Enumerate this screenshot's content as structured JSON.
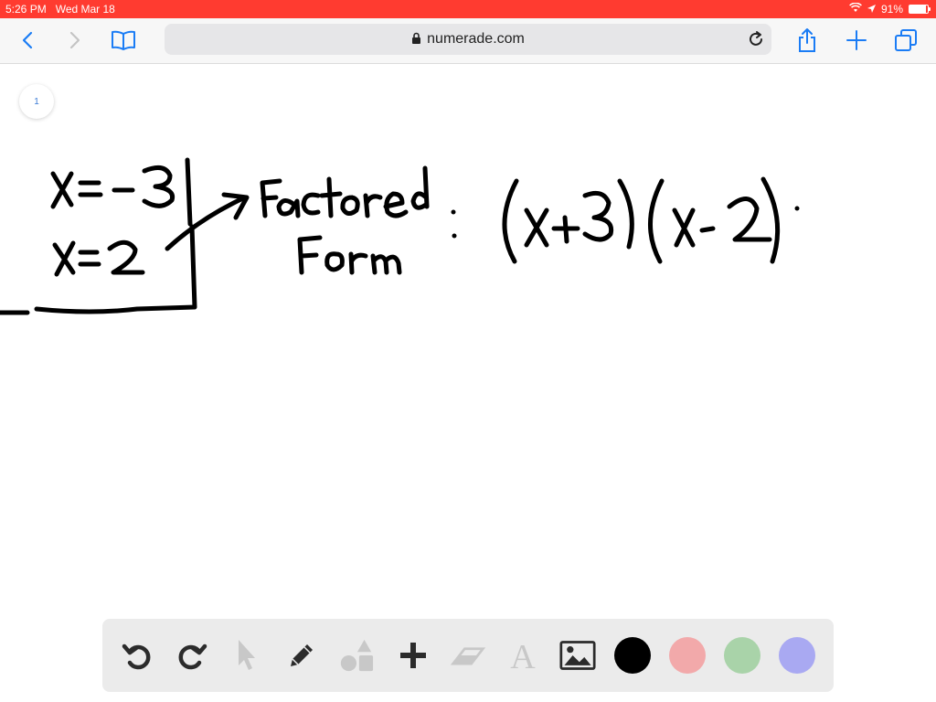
{
  "status_bar": {
    "time": "5:26 PM",
    "date": "Wed Mar 18",
    "battery": "91%",
    "battery_level": 0.91,
    "wifi_icon": "wifi-icon",
    "location_icon": "location-icon"
  },
  "browser": {
    "url": "numerade.com",
    "icons": [
      "back-icon",
      "forward-icon",
      "bookmarks-icon",
      "lock-icon",
      "reload-icon",
      "share-icon",
      "new-tab-icon",
      "tabs-icon"
    ]
  },
  "canvas": {
    "page_number": "1",
    "handwriting": {
      "root1": "x = -3",
      "root2": "x = 2",
      "label_line1": "Factored",
      "label_line2": "Form",
      "colon": ":",
      "expression": "(x+3)(x-2)."
    }
  },
  "drawing_tools": {
    "tools": [
      "undo-icon",
      "redo-icon",
      "pointer-icon",
      "pencil-icon",
      "shapes-icon",
      "plus-icon",
      "eraser-icon",
      "text-icon",
      "image-icon"
    ],
    "colors": [
      "#000000",
      "#f2a9aa",
      "#a9d3a9",
      "#a9a9f2"
    ],
    "selected_color": "#000000"
  }
}
